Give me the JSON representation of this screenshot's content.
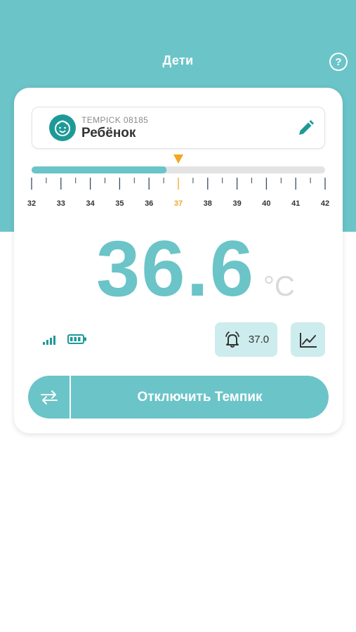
{
  "header": {
    "title": "Дети",
    "help_label": "?"
  },
  "device": {
    "id": "TEMPICK 08185",
    "name": "Ребёнок",
    "avatar_icon": "baby-face-icon",
    "edit_icon": "pencil-icon"
  },
  "scale": {
    "min": 32,
    "max": 42,
    "labels": [
      "32",
      "33",
      "34",
      "35",
      "36",
      "37",
      "38",
      "39",
      "40",
      "41",
      "42"
    ],
    "highlight_label": "37",
    "fill_value": 36.6,
    "marker_value": 37.0
  },
  "reading": {
    "value": "36.6",
    "unit": "°C"
  },
  "status": {
    "signal_icon": "signal-bars-icon",
    "battery_icon": "battery-icon"
  },
  "alarm": {
    "icon": "alarm-bell-icon",
    "threshold": "37.0"
  },
  "chart_button": {
    "icon": "line-chart-icon"
  },
  "actions": {
    "switch_icon": "swap-arrows-icon",
    "disconnect_label": "Отключить Темпик"
  },
  "colors": {
    "teal": "#6bc4c8",
    "teal_dark": "#1d9a98",
    "accent_orange": "#f5a623",
    "light_teal": "#cdeced",
    "track_gray": "#e3e3e3",
    "tick": "#3a4a66"
  }
}
